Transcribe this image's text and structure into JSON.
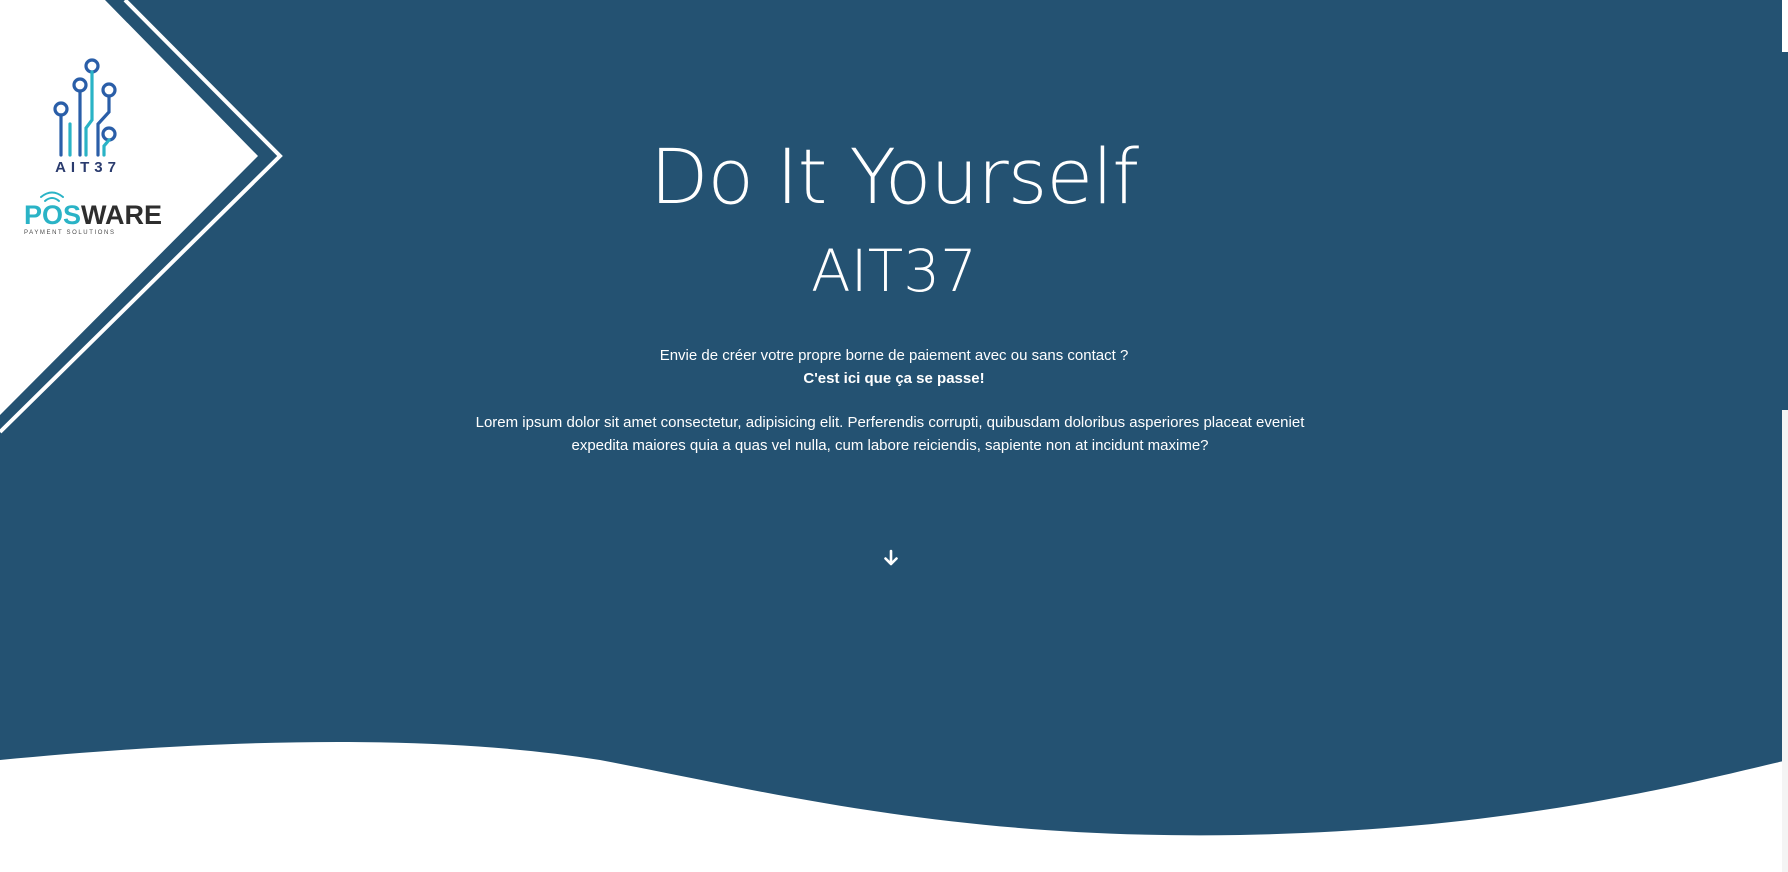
{
  "hero": {
    "title": "Do It Yourself",
    "subtitle": "AIT37",
    "intro_line": "Envie de créer votre propre borne de paiement avec ou sans contact ?",
    "intro_bold": "C'est ici que ça se passe!",
    "description": "Lorem ipsum dolor sit amet consectetur, adipisicing elit. Perferendis corrupti, quibusdam doloribus asperiores placeat eveniet expedita maiores quia a quas vel nulla, cum labore reiciendis, sapiente non at incidunt maxime?",
    "scroll_icon": "arrow-down-icon"
  },
  "logos": {
    "ait37_text": "AIT37",
    "posware_po": "P",
    "posware_o": "O",
    "posware_s": "S",
    "posware_ware": "WARE",
    "posware_tagline": "PAYMENT SOLUTIONS"
  },
  "colors": {
    "hero_bg": "#245272",
    "logo_blue": "#2a5ea8",
    "logo_teal": "#2ab3c6",
    "logo_dark": "#2e2e2e"
  }
}
